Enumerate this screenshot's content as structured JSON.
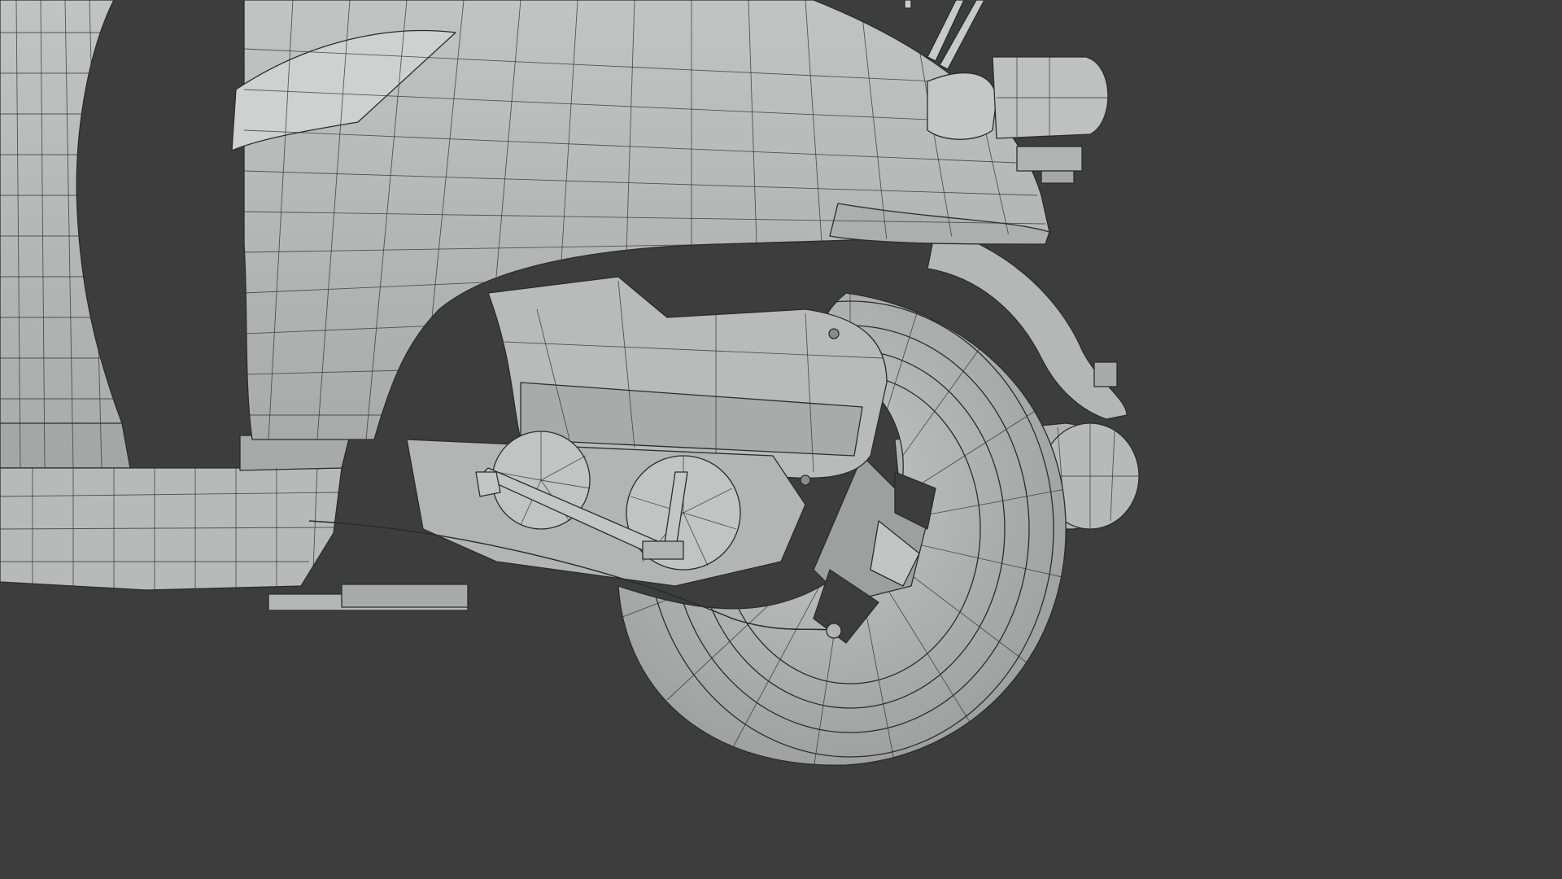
{
  "viewport": {
    "background_color": "#3d3d3d",
    "shading": "solid",
    "overlay": "wireframe",
    "mesh_color": "#b7b9b9",
    "edge_color": "#2a2c2c"
  },
  "scene": {
    "objects": [
      {
        "name": "body-panel"
      },
      {
        "name": "floorboard"
      },
      {
        "name": "front-leg-shield"
      },
      {
        "name": "rear-fender"
      },
      {
        "name": "engine-cover"
      },
      {
        "name": "cvt-case"
      },
      {
        "name": "muffler"
      },
      {
        "name": "rear-wheel-tire"
      },
      {
        "name": "rear-wheel-rim"
      },
      {
        "name": "tail-light"
      },
      {
        "name": "license-light"
      },
      {
        "name": "antenna-rods"
      },
      {
        "name": "kickstand"
      },
      {
        "name": "brake-cable"
      }
    ]
  }
}
